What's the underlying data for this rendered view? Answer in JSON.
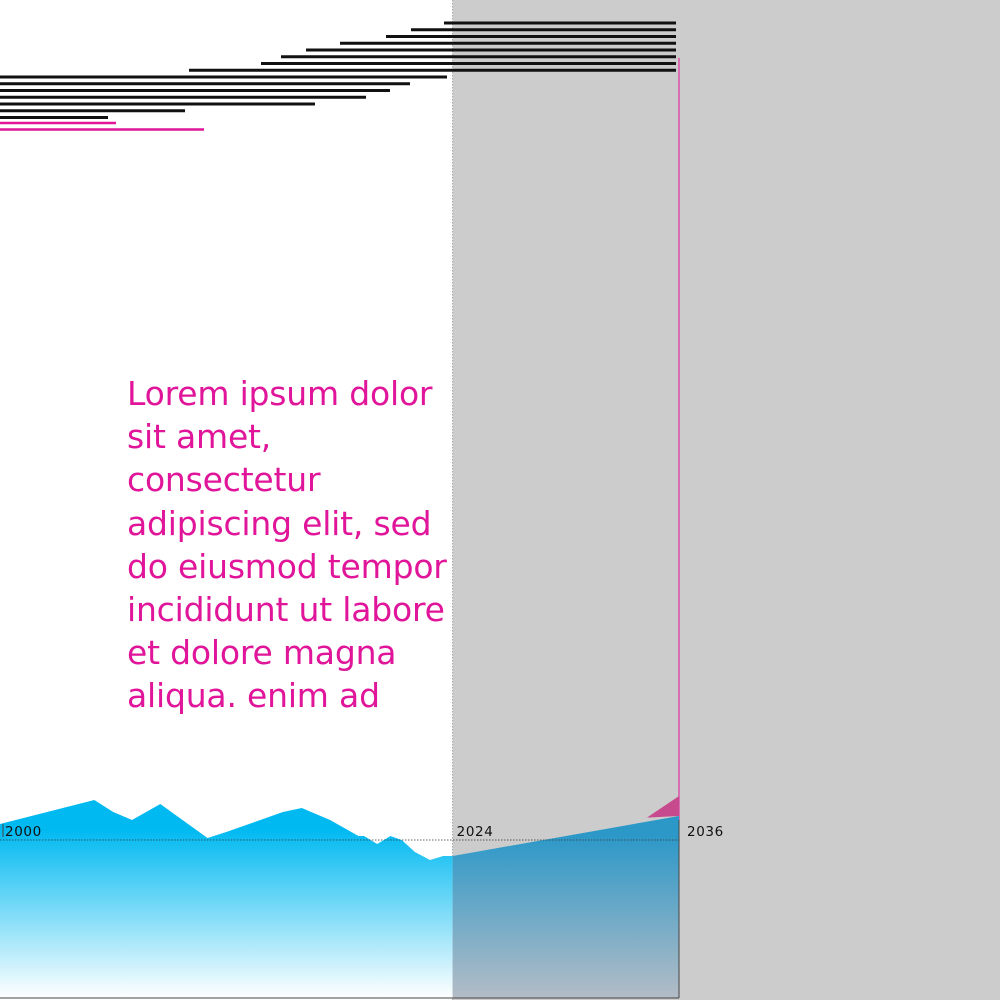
{
  "chart_data": {
    "type": "area",
    "subtype": "historical area with forecast period",
    "x_axis": {
      "ticks": [
        "2000",
        "2024",
        "2036"
      ],
      "range": [
        2000,
        2036
      ]
    },
    "forecast_start": 2024,
    "forecast_end": 2036,
    "grid": false,
    "series": [
      {
        "kind": "historical",
        "color": "#00b9f1",
        "x": [
          2000,
          2005,
          2006,
          2007,
          2008.5,
          2011,
          2012,
          2015,
          2016,
          2017.5,
          2019,
          2019.3,
          2020,
          2020.7,
          2021.3,
          2022,
          2022.8,
          2023.5,
          2024
        ],
        "y": [
          4,
          10,
          7,
          5,
          9,
          0.5,
          2,
          7,
          8,
          5,
          1,
          1,
          -1,
          1,
          0,
          -3,
          -5,
          -4,
          -4
        ]
      },
      {
        "kind": "forecast",
        "color": "#2b98c8",
        "x": [
          2024,
          2036
        ],
        "y": [
          -4,
          6
        ]
      }
    ],
    "forecast_overshoot": {
      "color": "#c84a8e",
      "x": [
        2034.3,
        2036
      ],
      "y_top": [
        5.6,
        11
      ],
      "y_bottom": [
        5.6,
        6
      ]
    },
    "stacked_bars": {
      "black_lengths": [
        232,
        265,
        290,
        336,
        370,
        395,
        415,
        487,
        447,
        410,
        390,
        366,
        315,
        185,
        108
      ],
      "pink_lengths": [
        116,
        204
      ],
      "black_color": "#111111",
      "pink_color": "#e0159a"
    }
  },
  "text": {
    "body": "Lorem ipsum dolor sit amet, consectetur adipiscing elit, sed do eiusmod tempor incididunt ut labore et dolore magna aliqua. enim ad"
  },
  "colors": {
    "accent": "#e0159a",
    "forecast_shade": "#cccccc",
    "baseline": "#333333"
  }
}
